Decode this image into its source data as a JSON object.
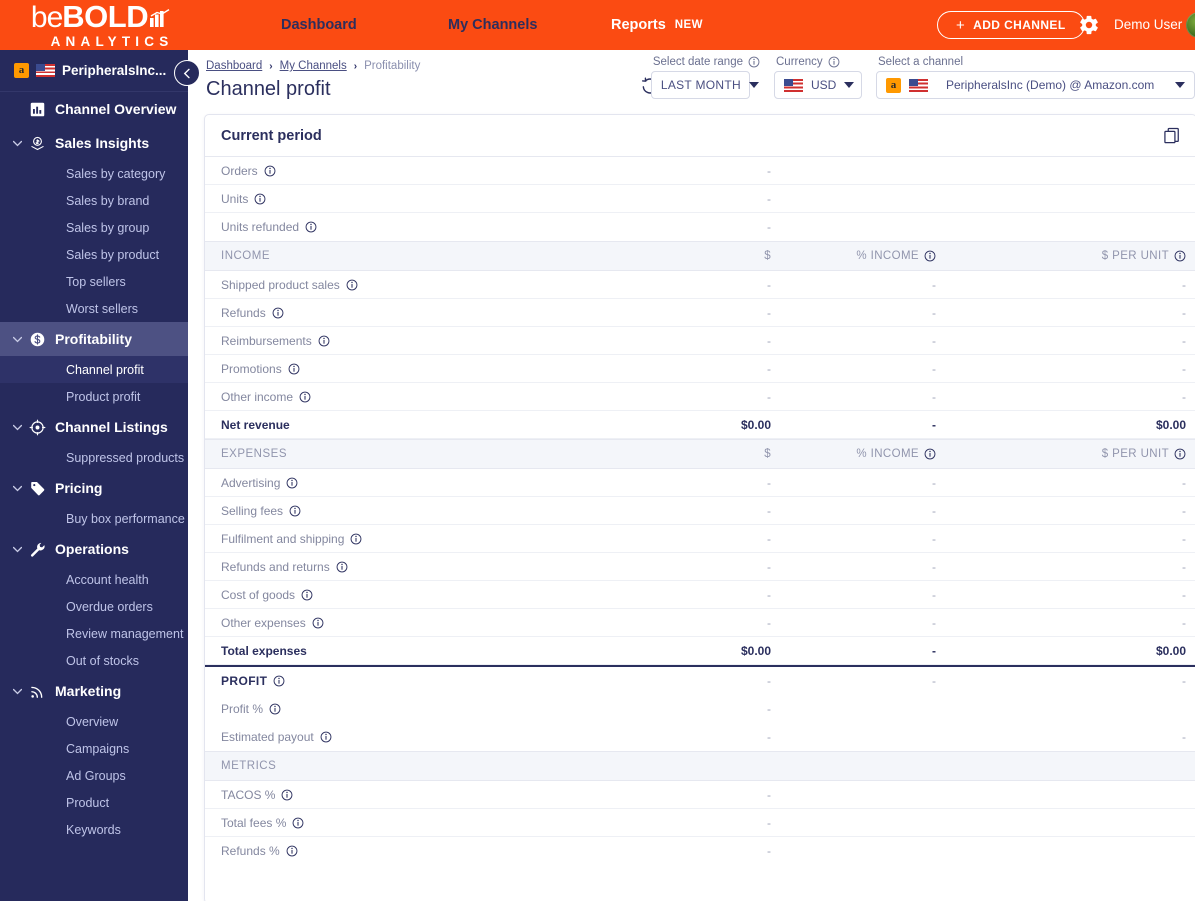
{
  "brand": {
    "logo_be": "be",
    "logo_bold": "BOLD",
    "logo_sub": "ANALYTICS",
    "accent_orange": "#fb4b12",
    "navy": "#262a5c"
  },
  "topnav": {
    "links": [
      {
        "label": "Dashboard",
        "badge": ""
      },
      {
        "label": "My Channels",
        "badge": ""
      },
      {
        "label": "Reports",
        "badge": "NEW"
      }
    ],
    "add_channel_label": "ADD CHANNEL",
    "add_channel_plus": "+",
    "gear_icon": "gear-icon",
    "user_name": "Demo User",
    "avatar_icon": "avatar"
  },
  "sidebar": {
    "account_name": "PeripheralsInc...",
    "account_marketplace_icon": "amazon-icon",
    "account_flag_icon": "us-flag-icon",
    "collapse_icon": "chevron-left-icon",
    "sections": [
      {
        "label": "Channel Overview",
        "icon": "bar-chart-icon",
        "has_caret": false,
        "active": false,
        "items": []
      },
      {
        "label": "Sales Insights",
        "icon": "sales-insights-icon",
        "has_caret": true,
        "active": false,
        "items": [
          {
            "label": "Sales by category",
            "active": false
          },
          {
            "label": "Sales by brand",
            "active": false
          },
          {
            "label": "Sales by group",
            "active": false
          },
          {
            "label": "Sales by product",
            "active": false
          },
          {
            "label": "Top sellers",
            "active": false
          },
          {
            "label": "Worst sellers",
            "active": false
          }
        ]
      },
      {
        "label": "Profitability",
        "icon": "dollar-circle-icon",
        "has_caret": true,
        "active": true,
        "items": [
          {
            "label": "Channel profit",
            "active": true
          },
          {
            "label": "Product profit",
            "active": false
          }
        ]
      },
      {
        "label": "Channel Listings",
        "icon": "target-icon",
        "has_caret": true,
        "active": false,
        "items": [
          {
            "label": "Suppressed products",
            "active": false
          }
        ]
      },
      {
        "label": "Pricing",
        "icon": "tag-icon",
        "has_caret": true,
        "active": false,
        "items": [
          {
            "label": "Buy box performance",
            "active": false
          }
        ]
      },
      {
        "label": "Operations",
        "icon": "wrench-icon",
        "has_caret": true,
        "active": false,
        "items": [
          {
            "label": "Account health",
            "active": false
          },
          {
            "label": "Overdue orders",
            "active": false
          },
          {
            "label": "Review management",
            "active": false
          },
          {
            "label": "Out of stocks",
            "active": false
          }
        ]
      },
      {
        "label": "Marketing",
        "icon": "broadcast-icon",
        "has_caret": true,
        "active": false,
        "items": [
          {
            "label": "Overview",
            "active": false
          },
          {
            "label": "Campaigns",
            "active": false
          },
          {
            "label": "Ad Groups",
            "active": false
          },
          {
            "label": "Product",
            "active": false
          },
          {
            "label": "Keywords",
            "active": false
          }
        ]
      }
    ]
  },
  "page": {
    "breadcrumb": [
      "Dashboard",
      "My Channels",
      "Profitability"
    ],
    "breadcrumb_sep": "›",
    "title": "Channel profit",
    "refresh_icon": "refresh-icon"
  },
  "filters": {
    "date_range": {
      "label": "Select date range",
      "value": "LAST MONTH",
      "info_icon": "info-icon"
    },
    "currency": {
      "label": "Currency",
      "value": "USD",
      "info_icon": "info-icon",
      "flag_icon": "us-flag-icon"
    },
    "channel": {
      "label": "Select a channel",
      "value": "PeripheralsInc (Demo) @ Amazon.com",
      "marketplace_icon": "amazon-icon",
      "flag_icon": "us-flag-icon"
    }
  },
  "card": {
    "title": "Current period",
    "export_icon": "copy-icon"
  },
  "table": {
    "columns": {
      "amount": "$",
      "pct_income": "% INCOME",
      "per_unit": "$ PER UNIT"
    },
    "blocks": [
      {
        "type": "rows",
        "rows": [
          {
            "label": "Orders",
            "info": true,
            "amount": "-",
            "pct": "",
            "unit": ""
          },
          {
            "label": "Units",
            "info": true,
            "amount": "-",
            "pct": "",
            "unit": ""
          },
          {
            "label": "Units refunded",
            "info": true,
            "amount": "-",
            "pct": "",
            "unit": ""
          }
        ]
      },
      {
        "type": "section",
        "header": {
          "label": "INCOME",
          "amount": "$",
          "pct": "% INCOME",
          "unit": "$ PER UNIT"
        },
        "rows": [
          {
            "label": "Shipped product sales",
            "info": true,
            "amount": "-",
            "pct": "-",
            "unit": "-"
          },
          {
            "label": "Refunds",
            "info": true,
            "amount": "-",
            "pct": "-",
            "unit": "-"
          },
          {
            "label": "Reimbursements",
            "info": true,
            "amount": "-",
            "pct": "-",
            "unit": "-"
          },
          {
            "label": "Promotions",
            "info": true,
            "amount": "-",
            "pct": "-",
            "unit": "-"
          },
          {
            "label": "Other income",
            "info": true,
            "amount": "-",
            "pct": "-",
            "unit": "-"
          },
          {
            "label": "Net revenue",
            "info": false,
            "strong": true,
            "amount": "$0.00",
            "pct": "-",
            "unit": "$0.00"
          }
        ]
      },
      {
        "type": "section",
        "header": {
          "label": "EXPENSES",
          "amount": "$",
          "pct": "% INCOME",
          "unit": "$ PER UNIT"
        },
        "rows": [
          {
            "label": "Advertising",
            "info": true,
            "amount": "-",
            "pct": "-",
            "unit": "-"
          },
          {
            "label": "Selling fees",
            "info": true,
            "amount": "-",
            "pct": "-",
            "unit": "-"
          },
          {
            "label": "Fulfilment and shipping",
            "info": true,
            "amount": "-",
            "pct": "-",
            "unit": "-"
          },
          {
            "label": "Refunds and returns",
            "info": true,
            "amount": "-",
            "pct": "-",
            "unit": "-"
          },
          {
            "label": "Cost of goods",
            "info": true,
            "amount": "-",
            "pct": "-",
            "unit": "-"
          },
          {
            "label": "Other expenses",
            "info": true,
            "amount": "-",
            "pct": "-",
            "unit": "-"
          },
          {
            "label": "Total expenses",
            "info": false,
            "strong": true,
            "amount": "$0.00",
            "pct": "-",
            "unit": "$0.00"
          }
        ]
      },
      {
        "type": "profit",
        "rows": [
          {
            "label": "PROFIT",
            "info": true,
            "profit_head": true,
            "amount": "-",
            "pct": "-",
            "unit": "-"
          },
          {
            "label": "Profit %",
            "info": true,
            "amount": "-",
            "pct": "",
            "unit": ""
          },
          {
            "label": "Estimated payout",
            "info": true,
            "amount": "-",
            "pct": "",
            "unit": "-"
          }
        ]
      },
      {
        "type": "section",
        "header": {
          "label": "METRICS",
          "amount": "",
          "pct": "",
          "unit": ""
        },
        "rows": [
          {
            "label": "TACOS %",
            "info": true,
            "amount": "-",
            "pct": "",
            "unit": ""
          },
          {
            "label": "Total fees %",
            "info": true,
            "amount": "-",
            "pct": "",
            "unit": ""
          },
          {
            "label": "Refunds %",
            "info": true,
            "amount": "-",
            "pct": "",
            "unit": ""
          }
        ]
      }
    ]
  }
}
